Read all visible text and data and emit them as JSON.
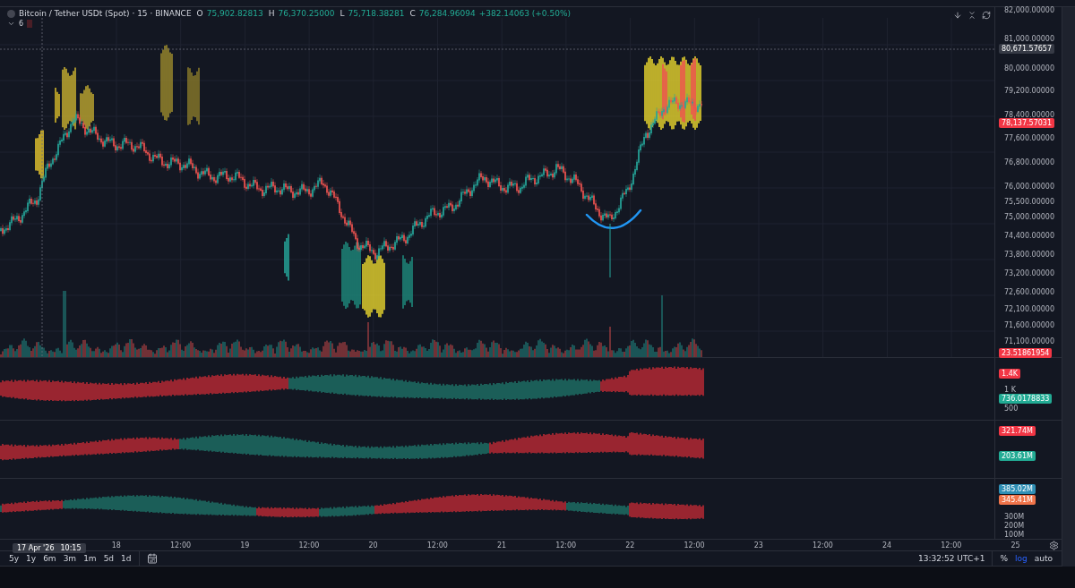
{
  "header": {
    "symbol": "Bitcoin / Tether USDt (Spot) · 15 · BINANCE",
    "ohlc": [
      {
        "label": "O",
        "value": "75,902.82813"
      },
      {
        "label": "H",
        "value": "76,370.25000"
      },
      {
        "label": "L",
        "value": "75,718.38281"
      },
      {
        "label": "C",
        "value": "76,284.96094"
      }
    ],
    "change": "+382.14063 (+0.50%)",
    "indicator_count": "6",
    "indicators_expanded": true
  },
  "price_axis": {
    "labels": [
      "82,000.00000",
      "81,000.00000",
      "80,000.00000",
      "79,200.00000",
      "78,400.00000",
      "77,600.00000",
      "76,800.00000",
      "76,000.00000",
      "75,500.00000",
      "75,000.00000",
      "74,400.00000",
      "73,800.00000",
      "73,200.00000",
      "72,600.00000",
      "72,100.00000",
      "71,600.00000",
      "71,100.00000"
    ],
    "badges": [
      {
        "text": "80,671.57657",
        "color": "#363a45"
      },
      {
        "text": "78,137.57031",
        "color": "#f23645"
      },
      {
        "text": "23.51861954",
        "color": "#f23645"
      }
    ]
  },
  "panes": [
    {
      "labels": [
        "1 K",
        "500"
      ],
      "badges": [
        {
          "text": "1.4K",
          "color": "#f23645"
        },
        {
          "text": "736.0178833",
          "color": "#22ab94"
        }
      ]
    },
    {
      "badges": [
        {
          "text": "321.74M",
          "color": "#f23645"
        },
        {
          "text": "203.61M",
          "color": "#22ab94"
        }
      ]
    },
    {
      "labels": [
        "300M",
        "200M",
        "100M"
      ],
      "badges": [
        {
          "text": "385.02M",
          "color": "#2f8fb5"
        },
        {
          "text": "345.41M",
          "color": "#f0744a"
        }
      ]
    }
  ],
  "time_axis": {
    "cursor_date": "17 Apr '26",
    "cursor_time": "10:15",
    "ticks": [
      "18",
      "12:00",
      "19",
      "12:00",
      "20",
      "12:00",
      "21",
      "12:00",
      "22",
      "12:00",
      "23",
      "12:00",
      "24",
      "12:00",
      "25"
    ]
  },
  "ranges": [
    "5y",
    "1y",
    "6m",
    "3m",
    "1m",
    "5d",
    "1d"
  ],
  "clock": "13:32:52 UTC+1",
  "scale_options": [
    {
      "label": "%",
      "selected": false
    },
    {
      "label": "log",
      "selected": true
    },
    {
      "label": "auto",
      "selected": false
    }
  ]
}
